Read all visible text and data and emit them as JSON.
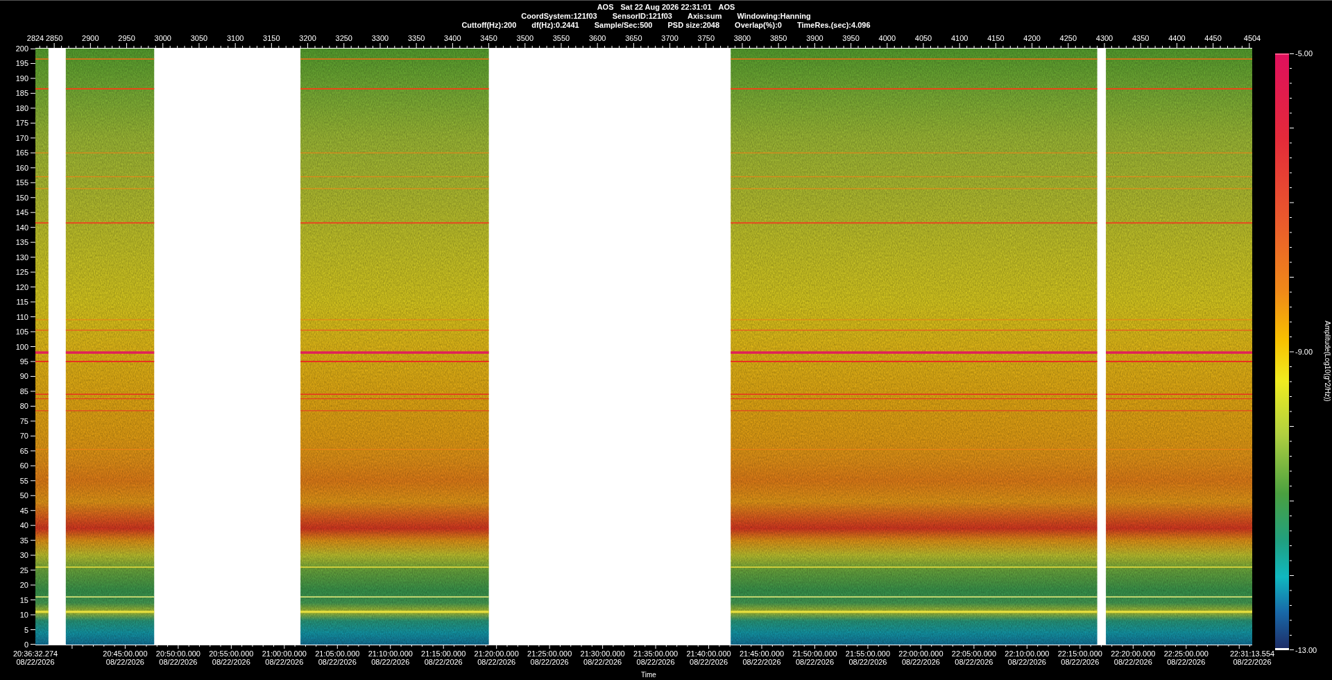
{
  "header": {
    "title_parts": [
      "AOS",
      "Sat 22 Aug 2026 22:31:01",
      "AOS"
    ],
    "settings": [
      "CoordSystem:121f03",
      "SensorID:121f03",
      "Axis:sum",
      "Windowing:Hanning"
    ],
    "parameters": [
      "Cuttoff(Hz):200",
      "df(Hz):0.2441",
      "Sample/Sec:500",
      "PSD size:2048",
      "Overlap(%):0",
      "TimeRes.(sec):4.096"
    ]
  },
  "spectrogram": {
    "x_axis_top": {
      "ticks": [
        "2824",
        "2850",
        "2900",
        "2950",
        "3000",
        "3050",
        "3100",
        "3150",
        "3200",
        "3250",
        "3300",
        "3350",
        "3400",
        "3450",
        "3500",
        "3550",
        "3600",
        "3650",
        "3700",
        "3750",
        "3800",
        "3850",
        "3900",
        "3950",
        "4000",
        "4050",
        "4100",
        "4150",
        "4200",
        "4250",
        "4300",
        "4350",
        "4400",
        "4450",
        "4504"
      ]
    },
    "y_axis": {
      "ticks": [
        "200",
        "195",
        "190",
        "185",
        "180",
        "175",
        "170",
        "165",
        "160",
        "155",
        "150",
        "145",
        "140",
        "135",
        "130",
        "125",
        "120",
        "115",
        "110",
        "105",
        "100",
        "95",
        "90",
        "85",
        "80",
        "75",
        "70",
        "65",
        "60",
        "55",
        "50",
        "45",
        "40",
        "35",
        "30",
        "25",
        "20",
        "15",
        "10",
        "5",
        "0"
      ]
    },
    "x_axis_bottom": {
      "label": "Time",
      "ticks": [
        {
          "time": "20:36:32.274",
          "date": "08/22/2026"
        },
        {
          "time": "20:45:00.000",
          "date": "08/22/2026"
        },
        {
          "time": "20:50:00.000",
          "date": "08/22/2026"
        },
        {
          "time": "20:55:00.000",
          "date": "08/22/2026"
        },
        {
          "time": "21:00:00.000",
          "date": "08/22/2026"
        },
        {
          "time": "21:05:00.000",
          "date": "08/22/2026"
        },
        {
          "time": "21:10:00.000",
          "date": "08/22/2026"
        },
        {
          "time": "21:15:00.000",
          "date": "08/22/2026"
        },
        {
          "time": "21:20:00.000",
          "date": "08/22/2026"
        },
        {
          "time": "21:25:00.000",
          "date": "08/22/2026"
        },
        {
          "time": "21:30:00.000",
          "date": "08/22/2026"
        },
        {
          "time": "21:35:00.000",
          "date": "08/22/2026"
        },
        {
          "time": "21:40:00.000",
          "date": "08/22/2026"
        },
        {
          "time": "21:45:00.000",
          "date": "08/22/2026"
        },
        {
          "time": "21:50:00.000",
          "date": "08/22/2026"
        },
        {
          "time": "21:55:00.000",
          "date": "08/22/2026"
        },
        {
          "time": "22:00:00.000",
          "date": "08/22/2026"
        },
        {
          "time": "22:05:00.000",
          "date": "08/22/2026"
        },
        {
          "time": "22:10:00.000",
          "date": "08/22/2026"
        },
        {
          "time": "22:15:00.000",
          "date": "08/22/2026"
        },
        {
          "time": "22:20:00.000",
          "date": "08/22/2026"
        },
        {
          "time": "22:25:00.000",
          "date": "08/22/2026"
        },
        {
          "time": "22:31:13.554",
          "date": "08/22/2026"
        }
      ]
    },
    "colorbar": {
      "label": "Amplitude(Log10(g^2/Hz))",
      "ticks": [
        "-5.00",
        "-9.00",
        "-13.00"
      ]
    }
  }
}
